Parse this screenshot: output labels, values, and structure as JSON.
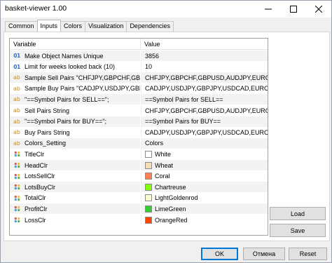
{
  "window": {
    "title": "basket-viewer 1.00"
  },
  "tabs": [
    {
      "label": "Common",
      "active": false
    },
    {
      "label": "Inputs",
      "active": true
    },
    {
      "label": "Colors",
      "active": false
    },
    {
      "label": "Visualization",
      "active": false
    },
    {
      "label": "Dependencies",
      "active": false
    }
  ],
  "table": {
    "headers": {
      "variable": "Variable",
      "value": "Value"
    },
    "rows": [
      {
        "type": "num",
        "icon": "01",
        "name": "Make Object Names Unique",
        "value": "3856"
      },
      {
        "type": "num",
        "icon": "01",
        "name": "Limit for weeks looked back (10)",
        "value": "10"
      },
      {
        "type": "str",
        "icon": "ab",
        "name": "Sample Sell Pairs \"CHFJPY,GBPCHF,GBP...",
        "value": "CHFJPY,GBPCHF,GBPUSD,AUDJPY,EURGBP,..."
      },
      {
        "type": "str",
        "icon": "ab",
        "name": "Sample Buy Pairs \"CADJPY,USDJPY,GBP...",
        "value": "CADJPY,USDJPY,GBPJPY,USDCAD,EURCHF,..."
      },
      {
        "type": "str",
        "icon": "ab",
        "name": "\"==Symbol Pairs for SELL==\";",
        "value": "==Symbol Pairs for SELL=="
      },
      {
        "type": "str",
        "icon": "ab",
        "name": "Sell Pairs String",
        "value": "CHFJPY,GBPCHF,GBPUSD,AUDJPY,EURGBP,..."
      },
      {
        "type": "str",
        "icon": "ab",
        "name": "\"==Symbol Pairs for BUY==\";",
        "value": "==Symbol Pairs for BUY=="
      },
      {
        "type": "str",
        "icon": "ab",
        "name": "Buy Pairs String",
        "value": "CADJPY,USDJPY,GBPJPY,USDCAD,EURCHF,..."
      },
      {
        "type": "str",
        "icon": "ab",
        "name": "Colors_Setting",
        "value": "Colors"
      },
      {
        "type": "color",
        "icon": "palette-icon",
        "name": "TitleClr",
        "value": "White",
        "swatch": "#ffffff"
      },
      {
        "type": "color",
        "icon": "palette-icon",
        "name": "HeadClr",
        "value": "Wheat",
        "swatch": "#f5deb3"
      },
      {
        "type": "color",
        "icon": "palette-icon",
        "name": "LotsSellClr",
        "value": "Coral",
        "swatch": "#ff7f50"
      },
      {
        "type": "color",
        "icon": "palette-icon",
        "name": "LotsBuyClr",
        "value": "Chartreuse",
        "swatch": "#7fff00"
      },
      {
        "type": "color",
        "icon": "palette-icon",
        "name": "TotalClr",
        "value": "LightGoldenrod",
        "swatch": "#fafad2"
      },
      {
        "type": "color",
        "icon": "palette-icon",
        "name": "ProfitClr",
        "value": "LimeGreen",
        "swatch": "#32cd32"
      },
      {
        "type": "color",
        "icon": "palette-icon",
        "name": "LossClr",
        "value": "OrangeRed",
        "swatch": "#ff4500"
      }
    ]
  },
  "side_buttons": {
    "load": "Load",
    "save": "Save"
  },
  "footer": {
    "ok": "OK",
    "cancel": "Отмена",
    "reset": "Reset"
  }
}
